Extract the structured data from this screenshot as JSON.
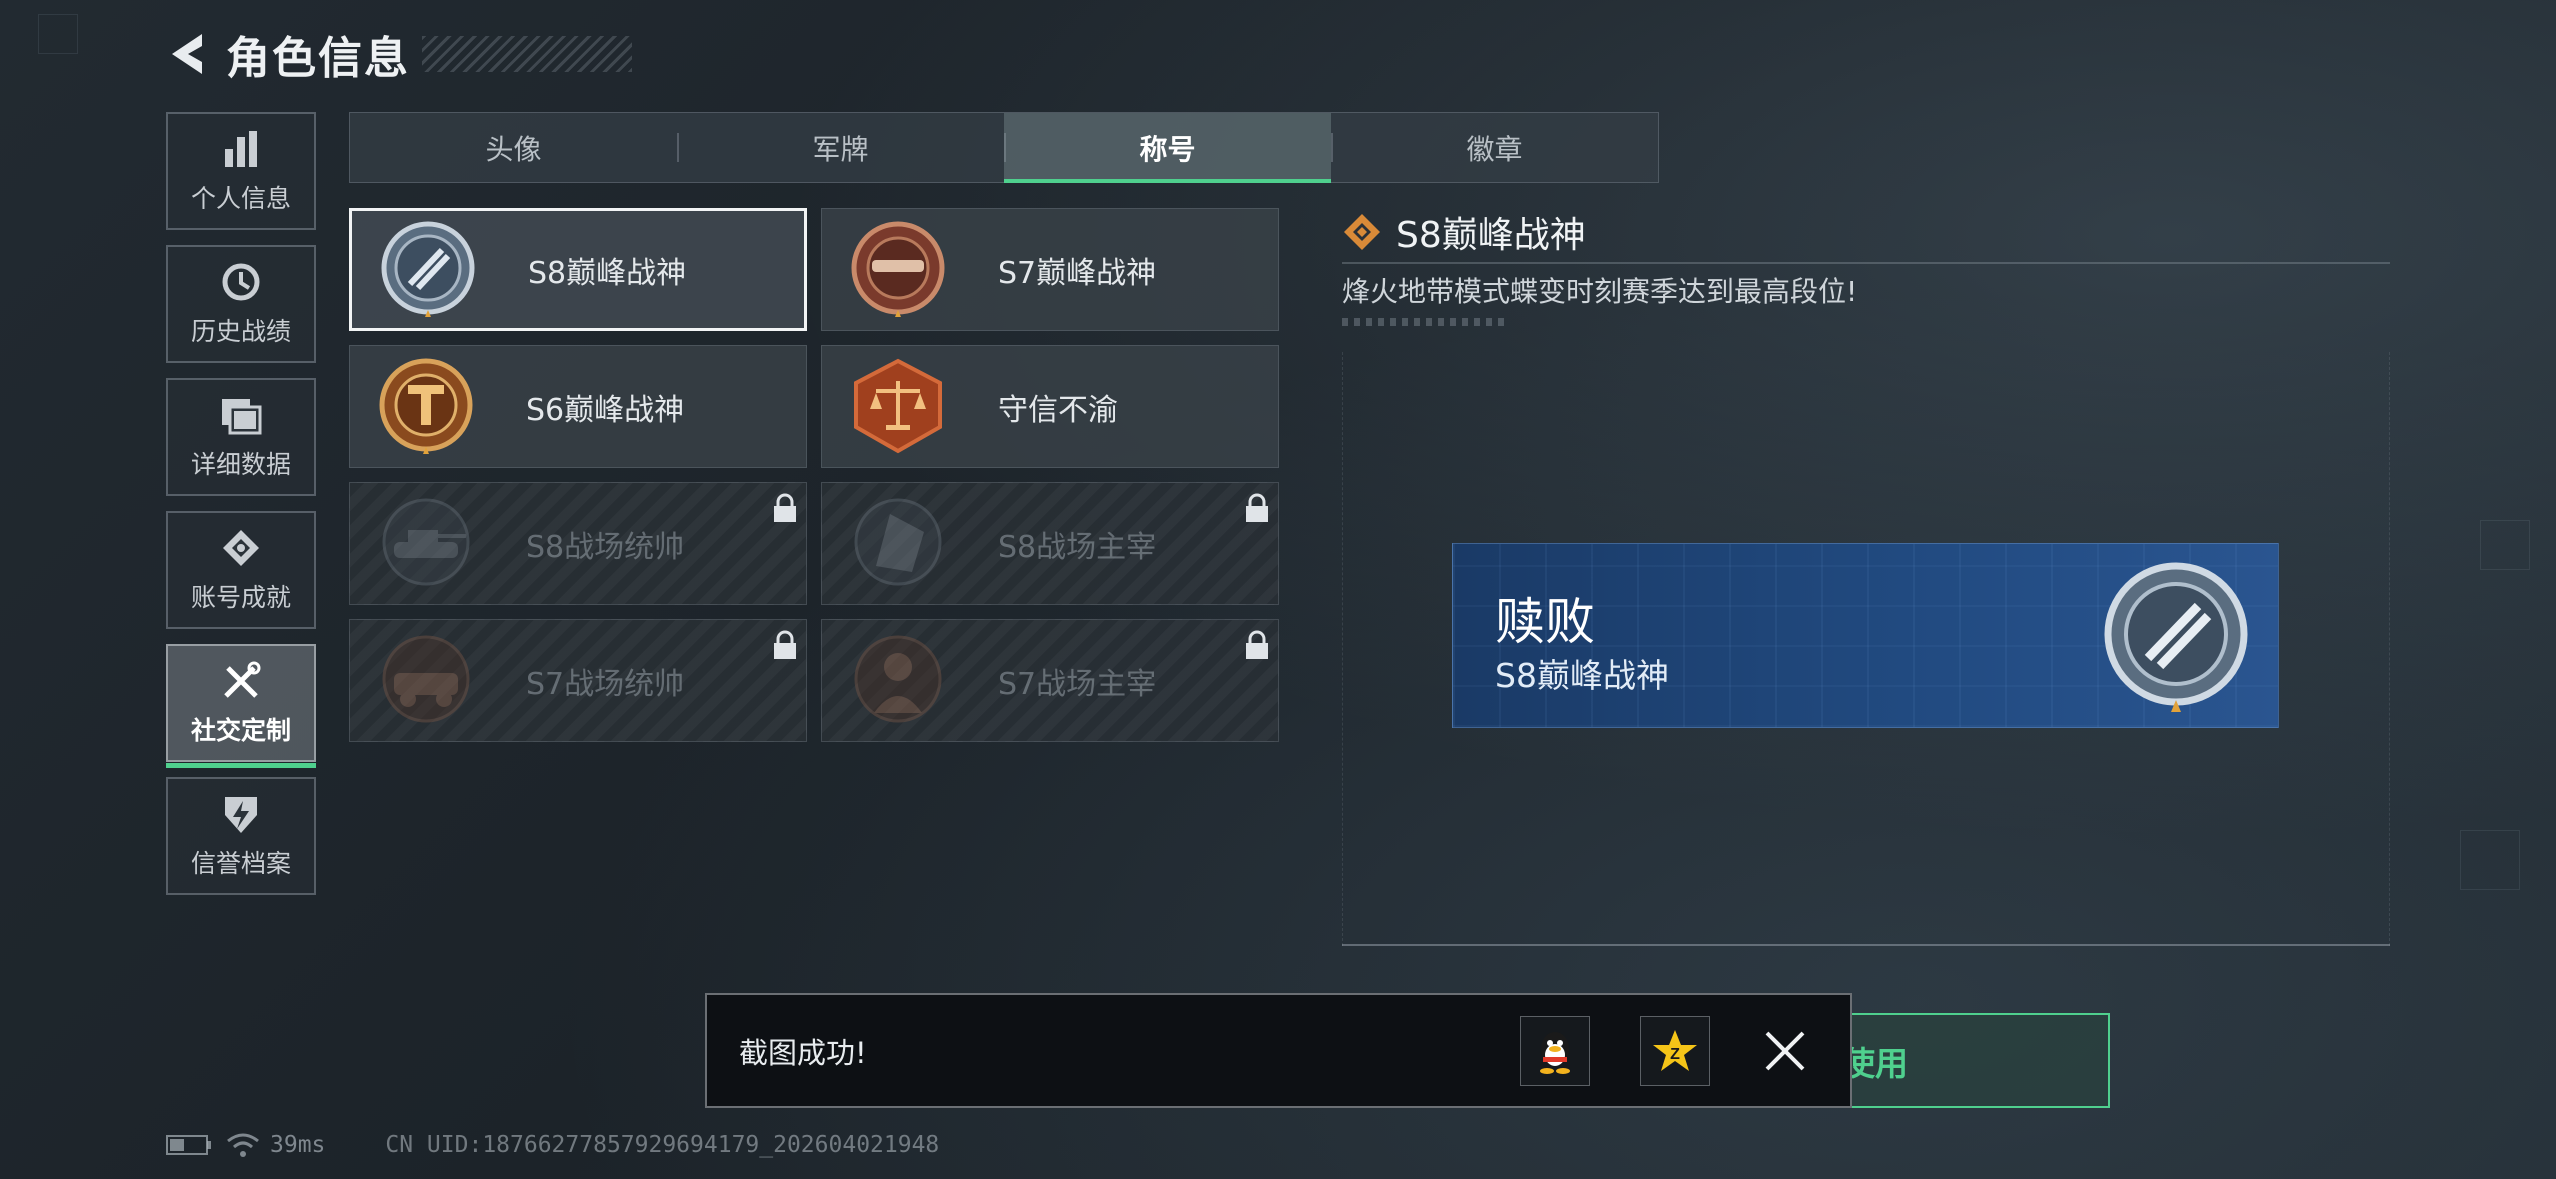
{
  "header": {
    "title": "角色信息"
  },
  "sidebar": {
    "items": [
      {
        "label": "个人信息",
        "icon": "bar-chart-icon"
      },
      {
        "label": "历史战绩",
        "icon": "history-clock-icon"
      },
      {
        "label": "详细数据",
        "icon": "folder-icon"
      },
      {
        "label": "账号成就",
        "icon": "medal-icon"
      },
      {
        "label": "社交定制",
        "icon": "tools-icon",
        "active": true
      },
      {
        "label": "信誉档案",
        "icon": "shield-bolt-icon"
      }
    ]
  },
  "tabs": [
    {
      "label": "头像"
    },
    {
      "label": "军牌"
    },
    {
      "label": "称号",
      "active": true
    },
    {
      "label": "徽章"
    }
  ],
  "titles": [
    {
      "name": "S8巅峰战神",
      "selected": true,
      "locked": false,
      "icon": "s8-peak-badge-icon"
    },
    {
      "name": "S7巅峰战神",
      "selected": false,
      "locked": false,
      "icon": "s7-peak-badge-icon"
    },
    {
      "name": "S6巅峰战神",
      "selected": false,
      "locked": false,
      "icon": "s6-peak-badge-icon"
    },
    {
      "name": "守信不渝",
      "selected": false,
      "locked": false,
      "icon": "scales-badge-icon"
    },
    {
      "name": "S8战场统帅",
      "selected": false,
      "locked": true,
      "icon": "tank-badge-icon"
    },
    {
      "name": "S8战场主宰",
      "selected": false,
      "locked": true,
      "icon": "building-badge-icon"
    },
    {
      "name": "S7战场统帅",
      "selected": false,
      "locked": true,
      "icon": "vehicle-badge-icon"
    },
    {
      "name": "S7战场主宰",
      "selected": false,
      "locked": true,
      "icon": "soldier-badge-icon"
    }
  ],
  "detail": {
    "title": "S8巅峰战神",
    "description": "烽火地带模式蝶变时刻赛季达到最高段位!",
    "preview": {
      "player_name": "赎败",
      "title": "S8巅峰战神"
    },
    "use_button": "使用"
  },
  "toast": {
    "message": "截图成功!"
  },
  "status": {
    "ping": "39ms",
    "uid": "CN UID:18766277857929694179_202604021948"
  },
  "colors": {
    "accent": "#4fd08e",
    "background": "#1f272e",
    "preview_blue": "#214a80"
  }
}
